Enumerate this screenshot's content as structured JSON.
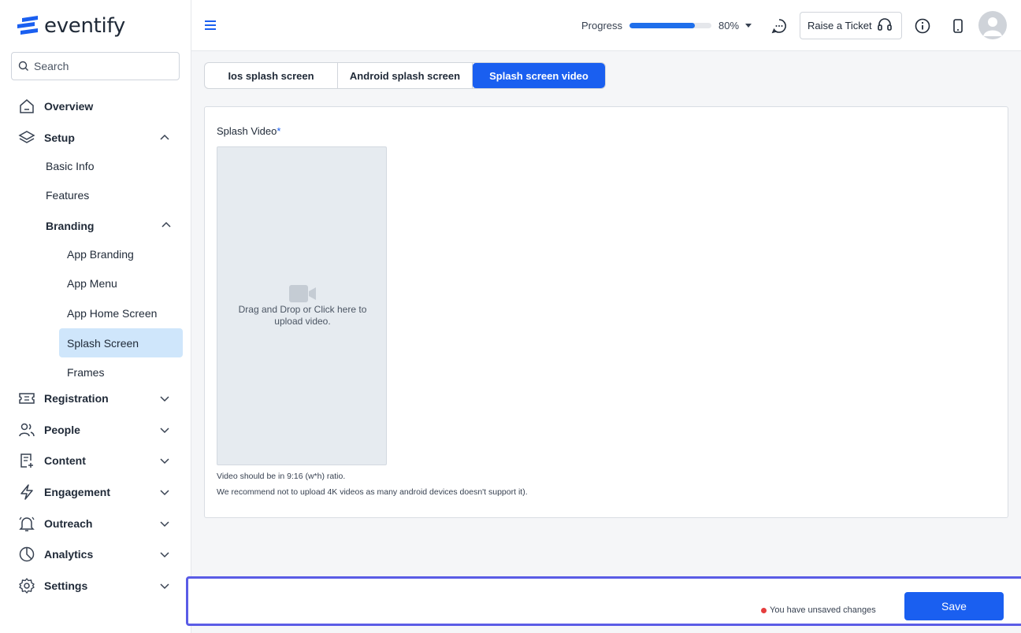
{
  "brand": {
    "name": "eventify",
    "accent": "#1a5ff0"
  },
  "search": {
    "placeholder": "Search"
  },
  "sidebar": {
    "overview": "Overview",
    "setup": "Setup",
    "setup_items": {
      "basic_info": "Basic Info",
      "features": "Features",
      "branding": "Branding"
    },
    "branding_items": {
      "app_branding": "App Branding",
      "app_menu": "App Menu",
      "app_home_screen": "App Home Screen",
      "splash_screen": "Splash Screen",
      "frames": "Frames"
    },
    "registration": "Registration",
    "people": "People",
    "content": "Content",
    "engagement": "Engagement",
    "outreach": "Outreach",
    "analytics": "Analytics",
    "settings": "Settings",
    "active_item": "Splash Screen"
  },
  "header": {
    "progress_label": "Progress",
    "progress_value": 80,
    "progress_text": "80%",
    "ticket_label": "Raise a Ticket"
  },
  "tabs": {
    "ios": "Ios splash screen",
    "android": "Android splash screen",
    "video": "Splash screen video",
    "active": "Splash screen video"
  },
  "form": {
    "label": "Splash Video",
    "required_mark": "*",
    "upload_text": "Drag and Drop or Click here to upload video.",
    "hint_ratio": "Video should be in 9:16 (w*h) ratio.",
    "hint_4k": "We recommend not to upload 4K videos as many android devices doesn't support it)."
  },
  "footer": {
    "unsaved_text": "You have unsaved changes",
    "save_label": "Save",
    "unsaved_dot_color": "#e53e3e"
  }
}
